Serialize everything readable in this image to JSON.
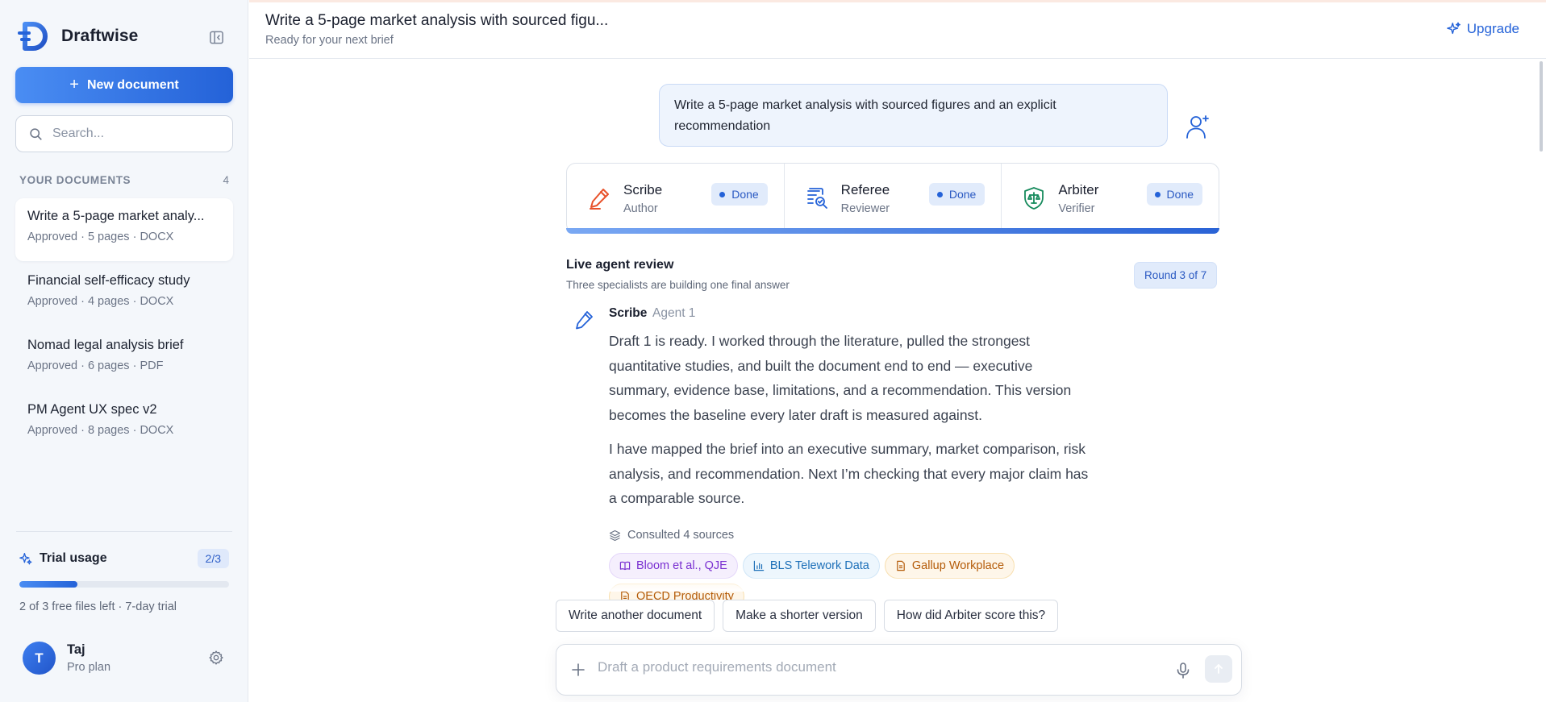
{
  "app": {
    "name": "Draftwise",
    "accent_color": "#2462d8"
  },
  "sidebar": {
    "new_document_label": "New document",
    "search_placeholder": "Search...",
    "documents_header": "YOUR DOCUMENTS",
    "documents_count": "4",
    "documents": [
      {
        "title": "Write a 5-page market analy...",
        "meta": "Approved · 5 pages · DOCX",
        "active": true
      },
      {
        "title": "Financial self-efficacy study",
        "meta": "Approved · 4 pages · DOCX",
        "active": false
      },
      {
        "title": "Nomad legal analysis brief",
        "meta": "Approved · 6 pages · PDF",
        "active": false
      },
      {
        "title": "PM Agent UX spec v2",
        "meta": "Approved · 8 pages · DOCX",
        "active": false
      }
    ],
    "trial": {
      "label": "Trial usage",
      "badge": "2/3",
      "progress_fraction": 0.2777,
      "text": "2 of 3 free files left · 7-day trial"
    },
    "user": {
      "initial": "T",
      "name": "Taj",
      "plan": "Pro plan"
    }
  },
  "header": {
    "title": "Write a 5-page market analysis with sourced figu...",
    "subtitle": "Ready for your next brief",
    "upgrade_label": "Upgrade"
  },
  "conversation": {
    "user_message": "Write a 5-page market analysis with sourced figures and an explicit recommendation",
    "agents": [
      {
        "name": "Scribe",
        "role": "Author",
        "status": "Done",
        "icon": "pen-icon",
        "color": "#e8522b"
      },
      {
        "name": "Referee",
        "role": "Reviewer",
        "status": "Done",
        "icon": "review-doc-icon",
        "color": "#2462d8"
      },
      {
        "name": "Arbiter",
        "role": "Verifier",
        "status": "Done",
        "icon": "shield-scale-icon",
        "color": "#168a5c"
      }
    ],
    "review": {
      "title": "Live agent review",
      "subtitle": "Three specialists are building one final answer",
      "round": "Round 3 of 7"
    },
    "message": {
      "author": "Scribe",
      "agent_label": "Agent 1",
      "paragraphs": [
        "Draft 1 is ready. I worked through the literature, pulled the strongest quantitative studies, and built the document end to end — executive summary, evidence base, limitations, and a recommendation. This version becomes the baseline every later draft is measured against.",
        "I have mapped the brief into an executive summary, market comparison, risk analysis, and recommendation. Next I’m checking that every major claim has a comparable source."
      ],
      "consulted_label": "Consulted 4 sources",
      "sources": [
        {
          "label": "Bloom et al., QJE",
          "style": "purple",
          "icon": "book-icon"
        },
        {
          "label": "BLS Telework Data",
          "style": "blue",
          "icon": "bar-chart-icon"
        },
        {
          "label": "Gallup Workplace",
          "style": "orange",
          "icon": "document-icon"
        },
        {
          "label": "OECD Productivity",
          "style": "orange",
          "icon": "document-icon"
        }
      ]
    },
    "suggestions": [
      "Write another document",
      "Make a shorter version",
      "How did Arbiter score this?"
    ],
    "composer_placeholder": "Draft a product requirements document"
  }
}
